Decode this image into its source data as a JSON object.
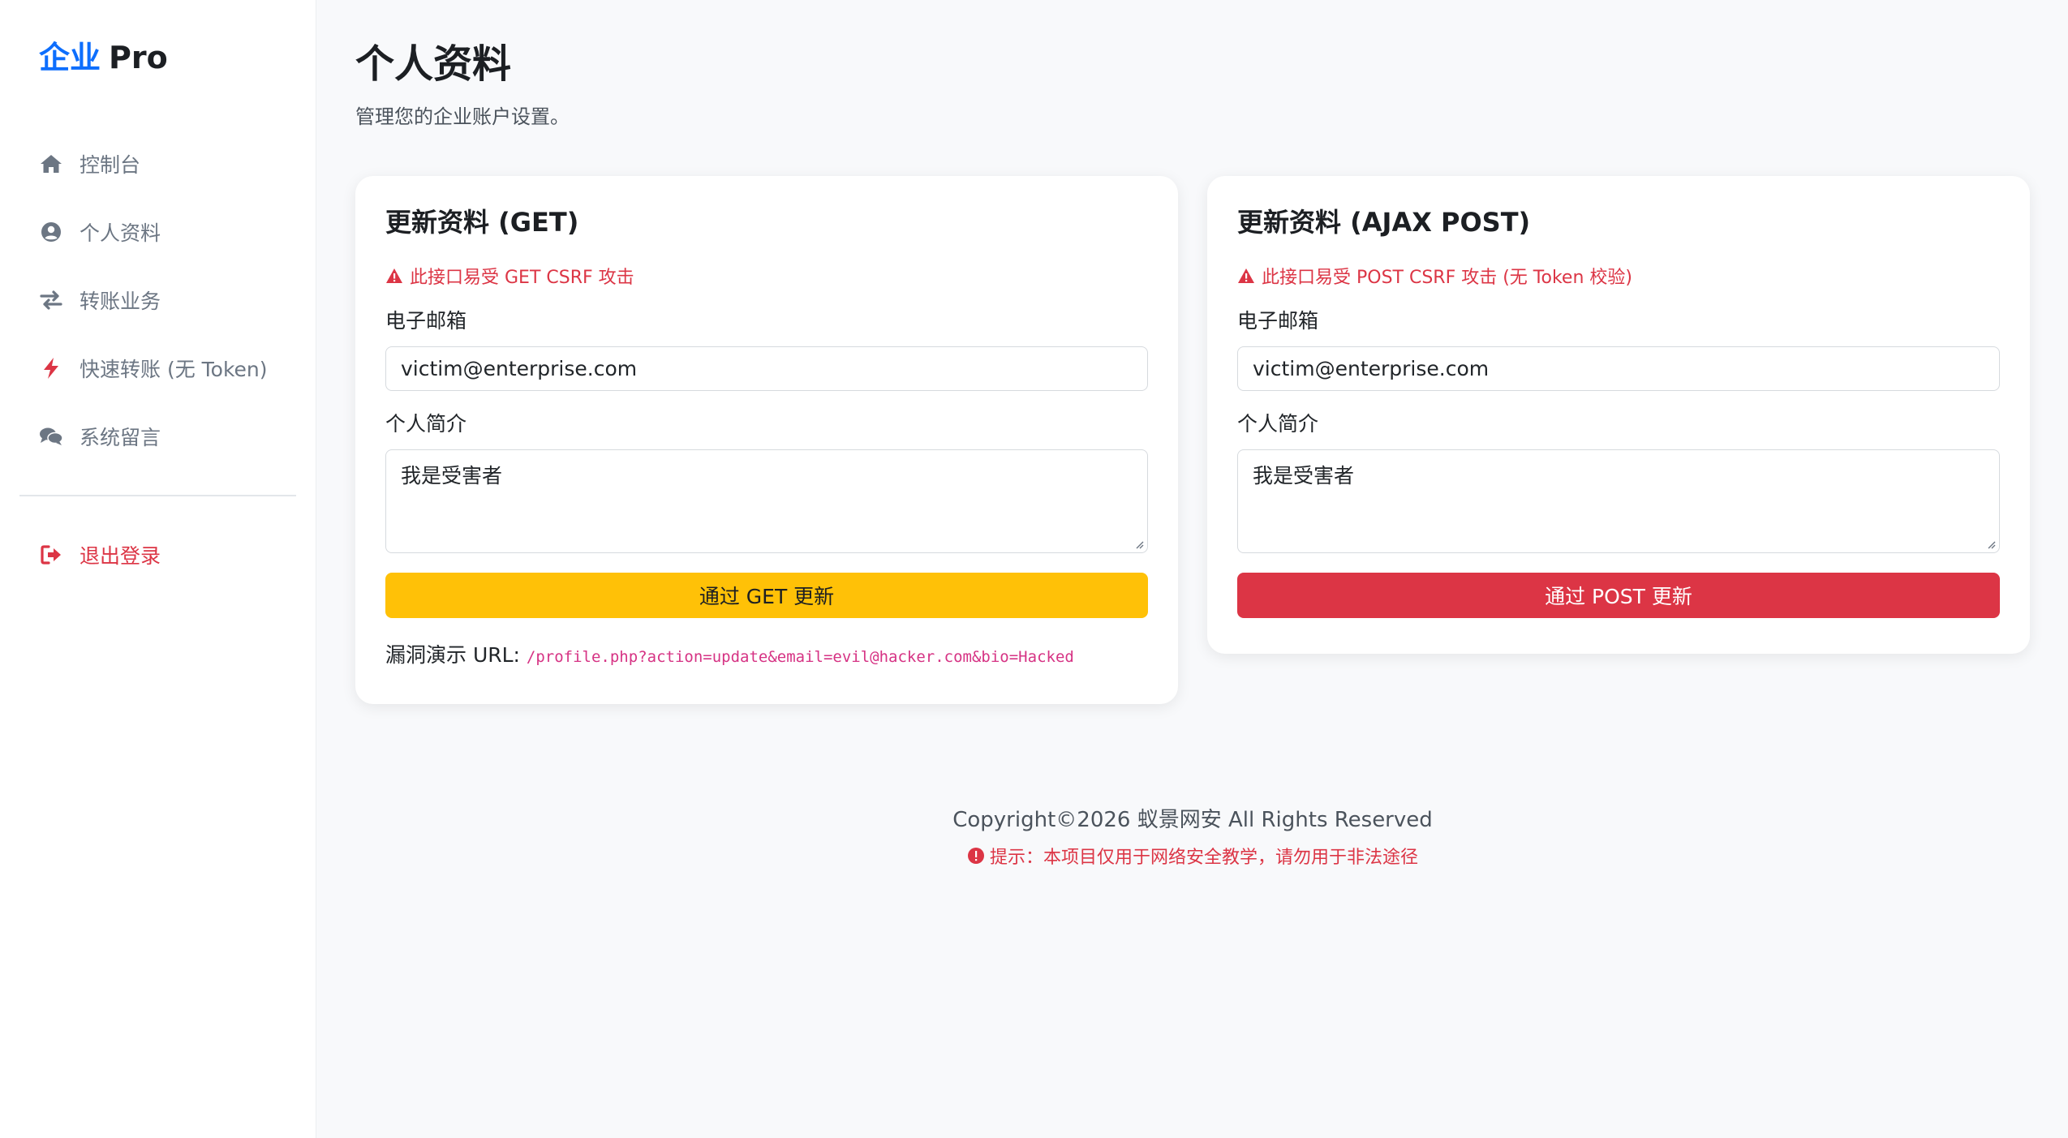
{
  "brand": {
    "accent": "企业",
    "rest": "Pro"
  },
  "sidebar": {
    "items": [
      {
        "label": "控制台",
        "icon": "home-icon"
      },
      {
        "label": "个人资料",
        "icon": "user-circle-icon"
      },
      {
        "label": "转账业务",
        "icon": "exchange-icon"
      },
      {
        "label": "快速转账 (无 Token)",
        "icon": "bolt-icon"
      },
      {
        "label": "系统留言",
        "icon": "comments-icon"
      }
    ],
    "logout": {
      "label": "退出登录",
      "icon": "sign-out-icon"
    }
  },
  "page": {
    "title": "个人资料",
    "subtitle": "管理您的企业账户设置。"
  },
  "card_get": {
    "title": "更新资料 (GET)",
    "warning": "此接口易受 GET CSRF 攻击",
    "email_label": "电子邮箱",
    "email_value": "victim@enterprise.com",
    "bio_label": "个人简介",
    "bio_value": "我是受害者",
    "button": "通过 GET 更新",
    "url_label": "漏洞演示 URL:",
    "url_value": "/profile.php?action=update&email=evil@hacker.com&bio=Hacked"
  },
  "card_post": {
    "title": "更新资料 (AJAX POST)",
    "warning": "此接口易受 POST CSRF 攻击 (无 Token 校验)",
    "email_label": "电子邮箱",
    "email_value": "victim@enterprise.com",
    "bio_label": "个人简介",
    "bio_value": "我是受害者",
    "button": "通过 POST 更新"
  },
  "footer": {
    "copyright": "Copyright©2026 蚁景网安 All Rights Reserved",
    "notice": "提示：本项目仅用于网络安全教学，请勿用于非法途径"
  },
  "colors": {
    "primary": "#0d6efd",
    "danger": "#dc3545",
    "warning": "#ffc107",
    "muted": "#6c7683"
  }
}
